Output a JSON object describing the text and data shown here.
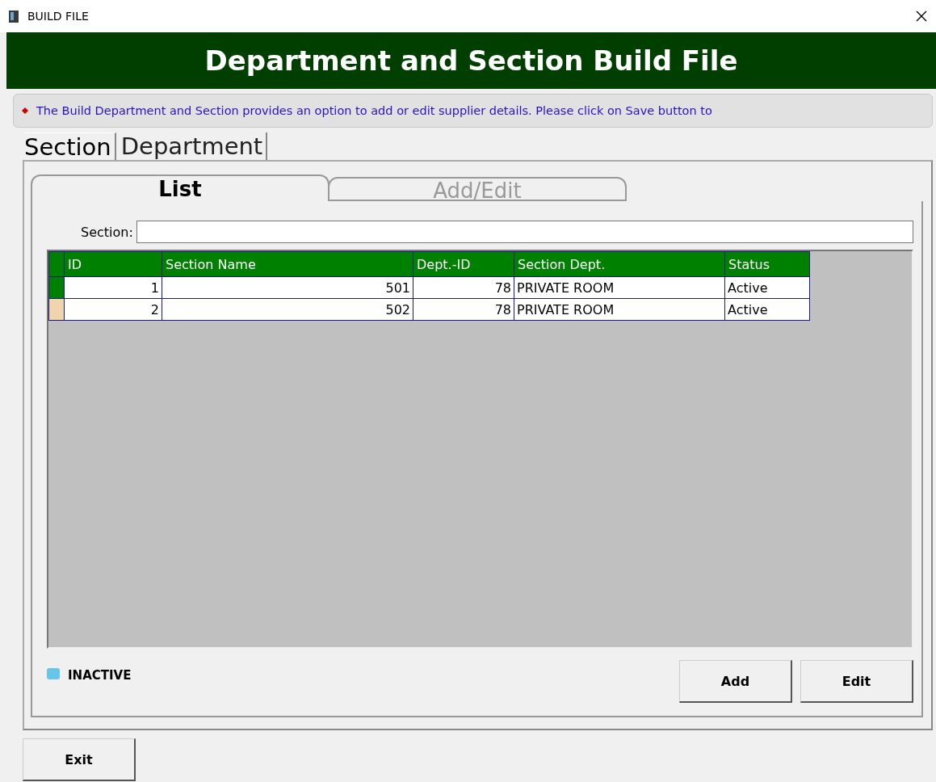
{
  "window": {
    "title": "BUILD FILE"
  },
  "header": {
    "title": "Department and Section Build File"
  },
  "info": {
    "text": "The Build Department and Section provides an option to add or edit supplier details. Please click on Save button to"
  },
  "top_tabs": [
    {
      "label": "Section",
      "selected": true
    },
    {
      "label": "Department",
      "selected": false
    }
  ],
  "inner_tabs": [
    {
      "label": "List",
      "selected": true
    },
    {
      "label": "Add/Edit",
      "selected": false
    }
  ],
  "search": {
    "label": "Section:"
  },
  "table": {
    "columns": [
      "ID",
      "Section Name",
      "Dept.-ID",
      "Section Dept.",
      "Status"
    ],
    "rows": [
      {
        "selected": true,
        "cells": [
          "1",
          "501",
          "78",
          "PRIVATE ROOM",
          "Active"
        ]
      },
      {
        "selected": false,
        "cells": [
          "2",
          "502",
          "78",
          "PRIVATE ROOM",
          "Active"
        ]
      }
    ]
  },
  "legend": [
    {
      "label": "INACTIVE",
      "color": "#66c6ea"
    }
  ],
  "buttons": [
    "Add",
    "Edit"
  ],
  "footer_buttons": [
    "Exit"
  ]
}
